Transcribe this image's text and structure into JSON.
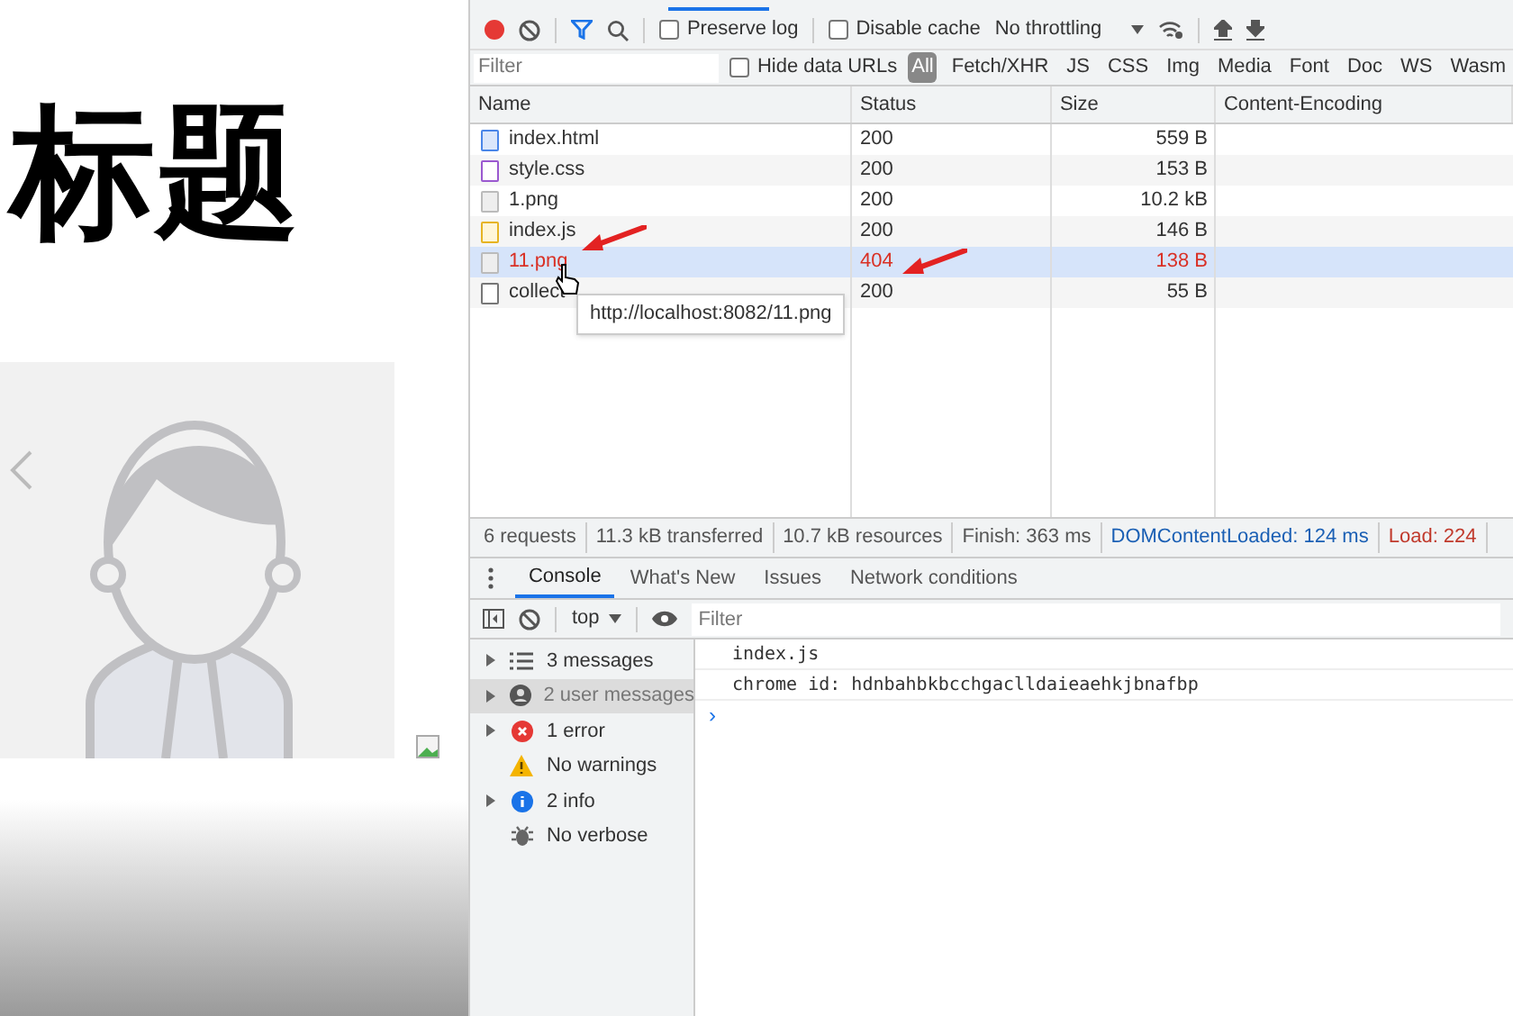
{
  "page": {
    "heading": "标题"
  },
  "devtools": {
    "toolbar": {
      "recording": true,
      "preserve_log": {
        "label": "Preserve log",
        "checked": false
      },
      "disable_cache": {
        "label": "Disable cache",
        "checked": false
      },
      "throttling": "No throttling"
    },
    "filter_bar": {
      "placeholder": "Filter",
      "hide_data_urls": {
        "label": "Hide data URLs",
        "checked": false
      },
      "types": [
        {
          "label": "All",
          "selected": true
        },
        {
          "label": "Fetch/XHR",
          "selected": false
        },
        {
          "label": "JS",
          "selected": false
        },
        {
          "label": "CSS",
          "selected": false
        },
        {
          "label": "Img",
          "selected": false
        },
        {
          "label": "Media",
          "selected": false
        },
        {
          "label": "Font",
          "selected": false
        },
        {
          "label": "Doc",
          "selected": false
        },
        {
          "label": "WS",
          "selected": false
        },
        {
          "label": "Wasm",
          "selected": false
        }
      ]
    },
    "table": {
      "columns": [
        "Name",
        "Status",
        "Size",
        "Content-Encoding"
      ],
      "rows": [
        {
          "kind": "doc",
          "name": "index.html",
          "status": "200",
          "size": "559 B",
          "error": false,
          "selected": false
        },
        {
          "kind": "css",
          "name": "style.css",
          "status": "200",
          "size": "153 B",
          "error": false,
          "selected": false
        },
        {
          "kind": "img",
          "name": "1.png",
          "status": "200",
          "size": "10.2 kB",
          "error": false,
          "selected": false
        },
        {
          "kind": "js",
          "name": "index.js",
          "status": "200",
          "size": "146 B",
          "error": false,
          "selected": false
        },
        {
          "kind": "img",
          "name": "11.png",
          "status": "404",
          "size": "138 B",
          "error": true,
          "selected": true
        },
        {
          "kind": "other",
          "name": "collect",
          "status": "200",
          "size": "55 B",
          "error": false,
          "selected": false
        }
      ],
      "tooltip": "http://localhost:8082/11.png"
    },
    "summary": [
      {
        "kind": "plain",
        "text": "6 requests"
      },
      {
        "kind": "plain",
        "text": "11.3 kB transferred"
      },
      {
        "kind": "plain",
        "text": "10.7 kB resources"
      },
      {
        "kind": "plain",
        "text": "Finish: 363 ms"
      },
      {
        "kind": "dom",
        "text": "DOMContentLoaded: 124 ms"
      },
      {
        "kind": "load",
        "text": "Load: 224"
      }
    ],
    "drawer_tabs": [
      {
        "label": "Console",
        "selected": true
      },
      {
        "label": "What's New",
        "selected": false
      },
      {
        "label": "Issues",
        "selected": false
      },
      {
        "label": "Network conditions",
        "selected": false
      }
    ],
    "console_toolbar": {
      "context": "top",
      "filter_placeholder": "Filter"
    },
    "sidebar": [
      {
        "kind": "list",
        "label": "3 messages",
        "expandable": true,
        "selected": false
      },
      {
        "kind": "user",
        "label": "2 user messages",
        "expandable": true,
        "selected": true
      },
      {
        "kind": "error",
        "label": "1 error",
        "expandable": true,
        "selected": false
      },
      {
        "kind": "warning",
        "label": "No warnings",
        "expandable": false,
        "selected": false
      },
      {
        "kind": "info",
        "label": "2 info",
        "expandable": true,
        "selected": false
      },
      {
        "kind": "verbose",
        "label": "No verbose",
        "expandable": false,
        "selected": false
      }
    ],
    "messages": [
      "index.js",
      "chrome id: hdnbahbkbcchgaclldaieaehkjbnafbp"
    ],
    "prompt": "›"
  }
}
